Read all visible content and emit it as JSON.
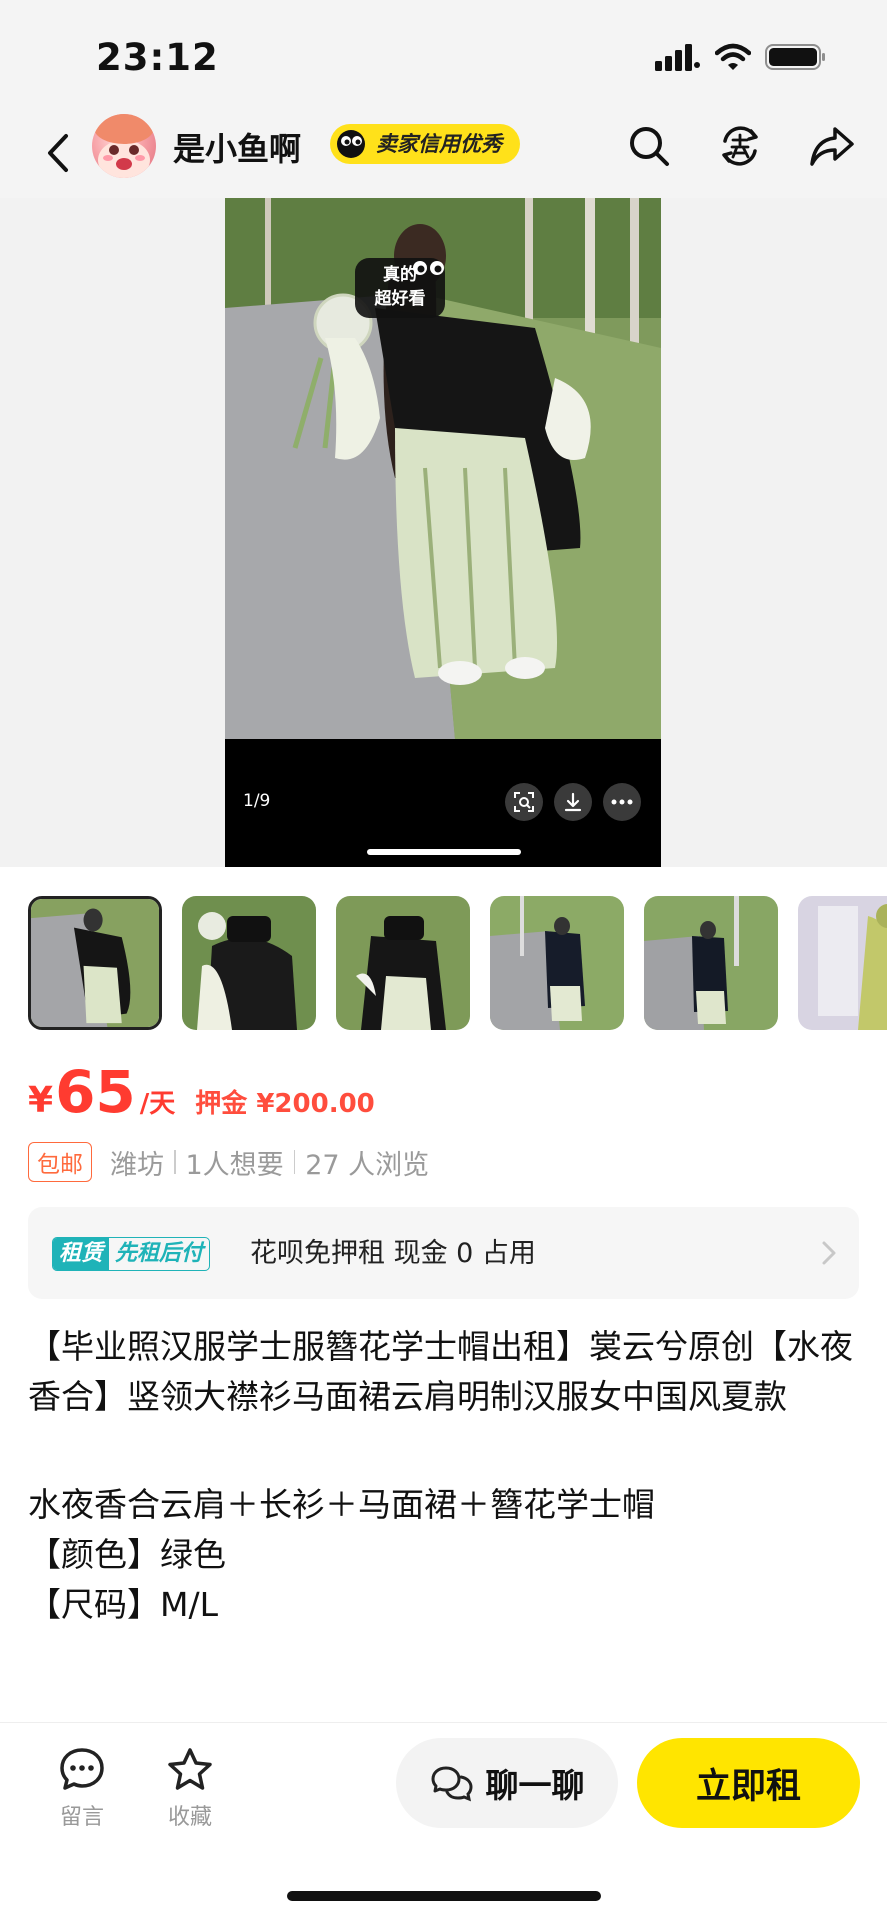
{
  "status": {
    "time": "23:12"
  },
  "header": {
    "seller_name": "是小鱼啊",
    "credit_badge": "卖家信用优秀",
    "icons": [
      "back-icon",
      "search-icon",
      "sell-icon",
      "share-icon"
    ]
  },
  "media": {
    "photo_sticker": "真的超好看",
    "page_indicator": "1/9",
    "controls": [
      "scan-icon",
      "download-icon",
      "more-icon"
    ]
  },
  "thumbnails": {
    "count_visible": 6,
    "selected_index": 0
  },
  "price": {
    "currency": "¥",
    "value": "65",
    "unit": "/天",
    "deposit": "押金 ¥200.00",
    "color": "#ff3b30"
  },
  "meta": {
    "free_shipping": "包邮",
    "location": "潍坊",
    "wants": "1人想要",
    "views": "27 人浏览"
  },
  "rent_banner": {
    "tag_a": "租赁",
    "tag_b": "先租后付",
    "text": "花呗免押租 现金 0 占用",
    "accent": "#1fb3b8"
  },
  "description": {
    "title": "【毕业照汉服学士服簪花学士帽出租】裳云兮原创【水夜香合】竖领大襟衫马面裙云肩明制汉服女中国风夏款",
    "line1": "水夜香合云肩＋长衫＋马面裙＋簪花学士帽",
    "line2": "【颜色】绿色",
    "line3": "【尺码】M/L"
  },
  "bottom_bar": {
    "comment_label": "留言",
    "favorite_label": "收藏",
    "chat_label": "聊一聊",
    "rent_label": "立即租",
    "rent_color": "#ffe500"
  }
}
